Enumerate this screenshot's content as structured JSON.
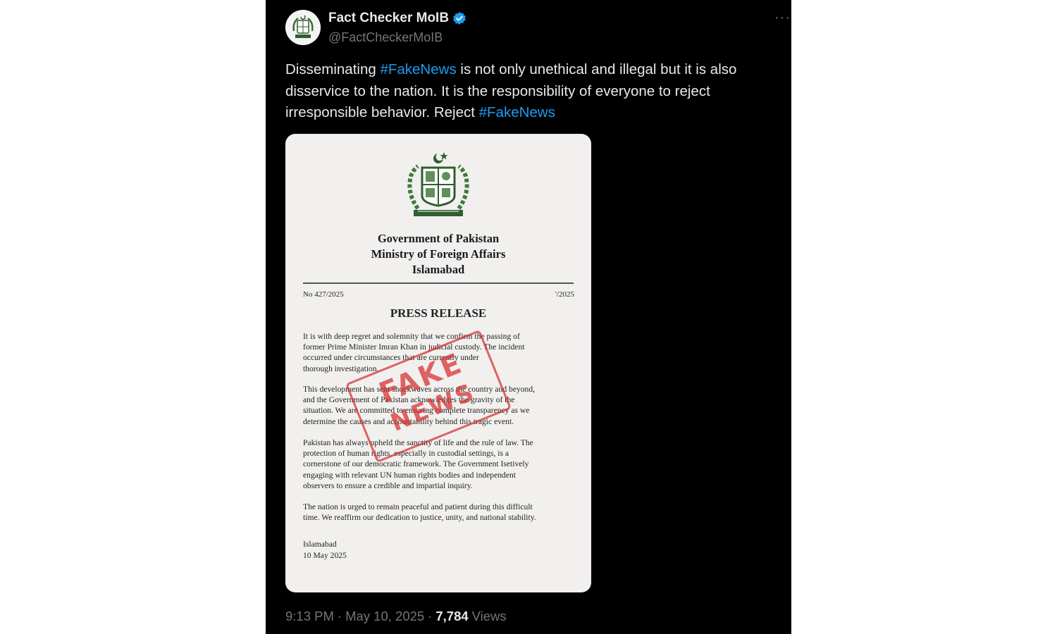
{
  "author": {
    "display_name": "Fact Checker MoIB",
    "handle": "@FactCheckerMoIB",
    "verified": true
  },
  "more_icon": "more-horizontal-icon",
  "tweet": {
    "text_1": "Disseminating ",
    "hashtag_1": "#FakeNews",
    "text_2": " is not only unethical and illegal but it is also disservice to the nation. It is the responsibility of everyone to reject irresponsible behavior. Reject ",
    "hashtag_2": "#FakeNews"
  },
  "document": {
    "header_1": "Government of Pakistan",
    "header_2": "Ministry of Foreign Affairs",
    "header_3": "Islamabad",
    "ref_no": "No 427/2025",
    "ref_date": "'/2025",
    "title": "PRESS RELEASE",
    "para_1": "It is with deep regret and solemnity that we confirm the passing of\nformer Prime Minister Imran Khan in judicial custody. The incident\noccurred under circumstances that are currently under\nthorough investigation.",
    "para_2": "This development has sent shockwaves across the country and beyond,\nand the Government of Pakistan acknowledges the gravity of the\nsituation. We are committed to ensuring complete transparency as we\ndetermine the causes and accountability behind this tragic event.",
    "para_3": "Pakistan has always upheld the sanctity of life and the rule of law. The\nprotection of human rights, especially in custodial settings, is a\ncornerstone of our democratic framework. The Government Isetively\nengaging with relevant UN human rights bodies and independent\nobservers to ensure a credible and impartial inquiry.",
    "para_4": "The nation is urged to remain peaceful and patient during this difficult\ntime. We reaffirm our dedication to justice, unity, and national stability.",
    "sign_1": "Islamabad",
    "sign_2": "10 May 2025",
    "stamp_line_1": "FAKE",
    "stamp_line_2": "NEWS"
  },
  "meta": {
    "time": "9:13 PM",
    "separator": "·",
    "date": "May 10, 2025",
    "views_count": "7,784",
    "views_label": "Views"
  },
  "colors": {
    "background": "#000000",
    "text": "#e7e9ea",
    "secondary": "#71767b",
    "accent": "#1d9bf0",
    "stamp": "#d62d2d"
  }
}
